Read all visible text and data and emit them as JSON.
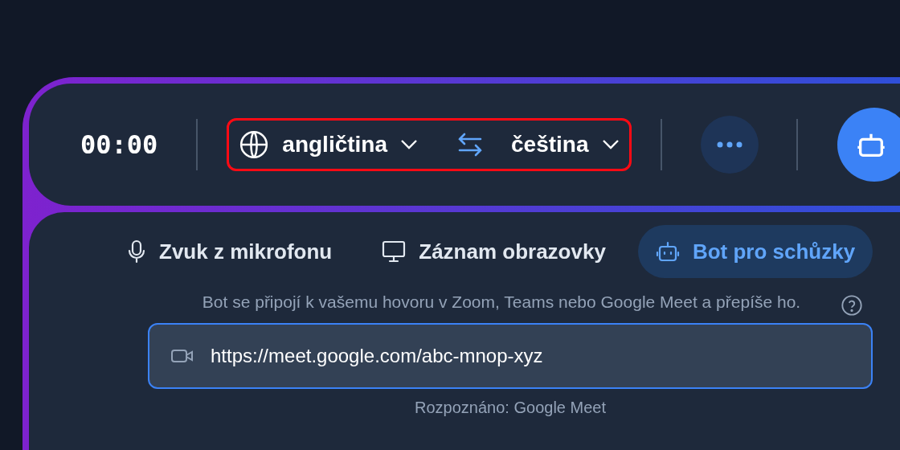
{
  "timer": "00:00",
  "language_selector": {
    "highlighted": true,
    "source": "angličtina",
    "target": "čeština"
  },
  "tabs": [
    {
      "kind": "microphone",
      "label": "Zvuk z mikrofonu",
      "selected": false
    },
    {
      "kind": "screen",
      "label": "Záznam obrazovky",
      "selected": false
    },
    {
      "kind": "bot",
      "label": "Bot pro schůzky",
      "selected": true
    }
  ],
  "description": "Bot se připojí k vašemu hovoru v Zoom, Teams nebo Google Meet a přepíše ho.",
  "url_field": {
    "value": "https://meet.google.com/abc-mnop-xyz"
  },
  "detected": "Rozpoznáno: Google Meet"
}
